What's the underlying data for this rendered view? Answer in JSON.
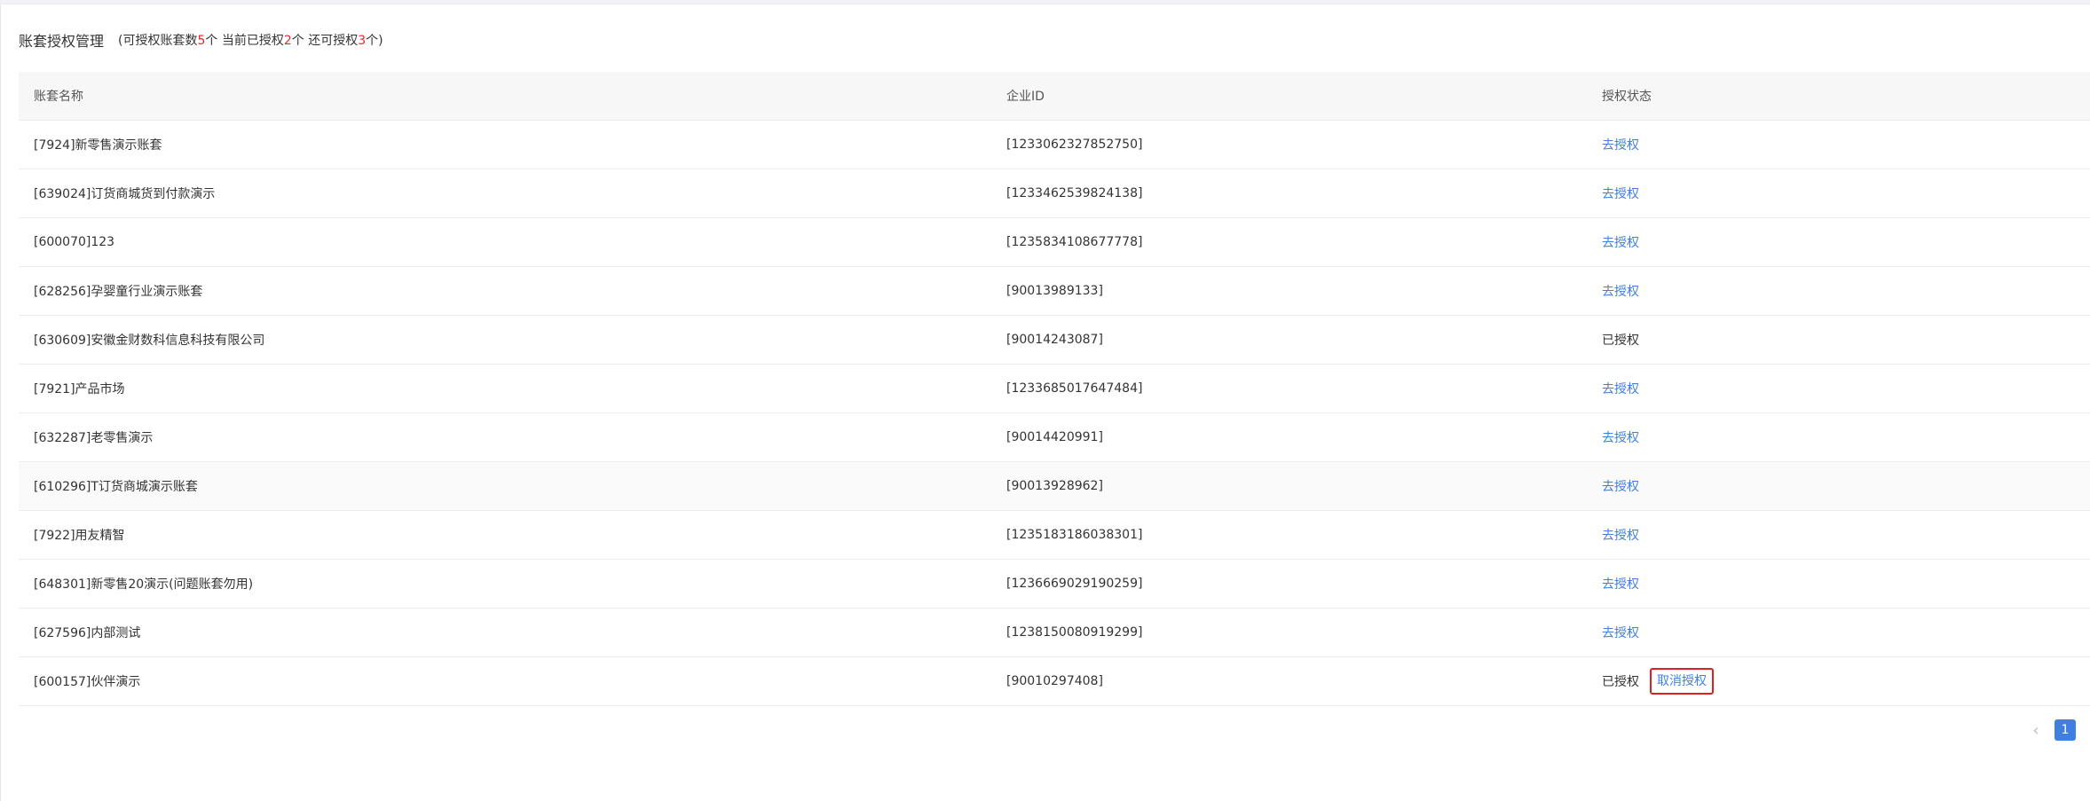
{
  "header": {
    "title": "账套授权管理",
    "note_prefix": "(可授权账套数",
    "total": "5",
    "note_mid1": "个 当前已授权",
    "authorized": "2",
    "note_mid2": "个 还可授权",
    "remaining": "3",
    "note_suffix": "个)"
  },
  "table": {
    "columns": [
      "账套名称",
      "企业ID",
      "授权状态"
    ],
    "rows": [
      {
        "name": "[7924]新零售演示账套",
        "enterprise_id": "[1233062327852750]",
        "status": "去授权"
      },
      {
        "name": "[639024]订货商城货到付款演示",
        "enterprise_id": "[1233462539824138]",
        "status": "去授权"
      },
      {
        "name": "[600070]123",
        "enterprise_id": "[1235834108677778]",
        "status": "去授权"
      },
      {
        "name": "[628256]孕婴童行业演示账套",
        "enterprise_id": "[90013989133]",
        "status": "去授权"
      },
      {
        "name": "[630609]安徽金财数科信息科技有限公司",
        "enterprise_id": "[90014243087]",
        "status": "已授权"
      },
      {
        "name": "[7921]产品市场",
        "enterprise_id": "[1233685017647484]",
        "status": "去授权"
      },
      {
        "name": "[632287]老零售演示",
        "enterprise_id": "[90014420991]",
        "status": "去授权"
      },
      {
        "name": "[610296]T订货商城演示账套",
        "enterprise_id": "[90013928962]",
        "status": "去授权"
      },
      {
        "name": "[7922]用友精智",
        "enterprise_id": "[1235183186038301]",
        "status": "去授权"
      },
      {
        "name": "[648301]新零售20演示(问题账套勿用)",
        "enterprise_id": "[1236669029190259]",
        "status": "去授权"
      },
      {
        "name": "[627596]内部测试",
        "enterprise_id": "[1238150080919299]",
        "status": "去授权"
      },
      {
        "name": "[600157]伙伴演示",
        "enterprise_id": "[90010297408]",
        "status": "已授权",
        "action": "取消授权"
      }
    ]
  },
  "pagination": {
    "prev_icon": "chevron-left-icon",
    "prev_glyph": "‹",
    "current_page": "1"
  },
  "colors": {
    "link": "#3f7fe0",
    "highlight_red": "#f5222d",
    "focus_border": "#e02020"
  }
}
